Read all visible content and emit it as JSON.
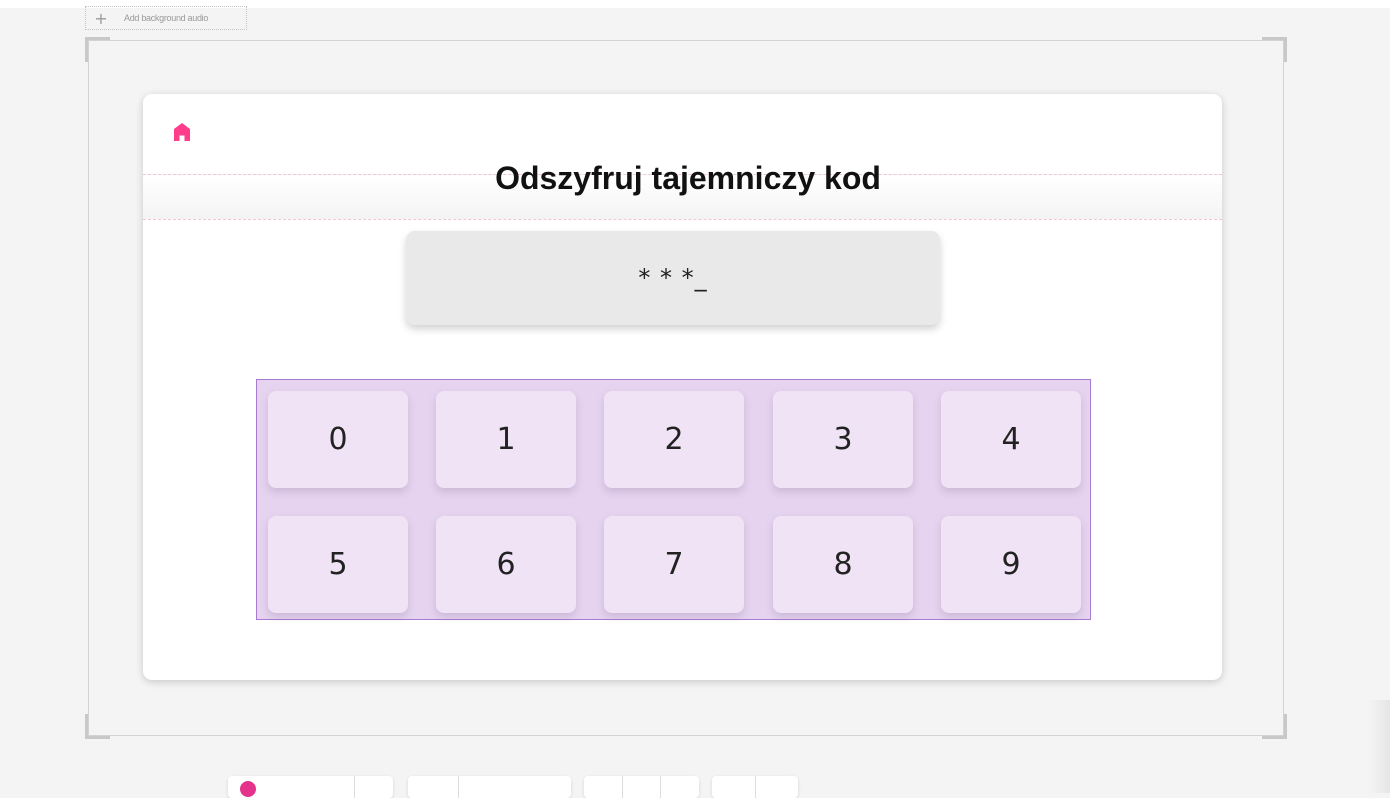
{
  "editor": {
    "add_background_audio_icon": "plus-icon",
    "add_background_audio_label": "Add background audio"
  },
  "slide": {
    "home_icon": "home-icon",
    "title": "Odszyfruj tajemniczy kod",
    "code_display": "* * *_",
    "keys": [
      "0",
      "1",
      "2",
      "3",
      "4",
      "5",
      "6",
      "7",
      "8",
      "9"
    ]
  },
  "colors": {
    "home_icon": "#ff3d8b",
    "keypad_bg": "#e5d3ef",
    "key_bg": "#f0e3f6",
    "display_bg": "#e9e9e9"
  }
}
